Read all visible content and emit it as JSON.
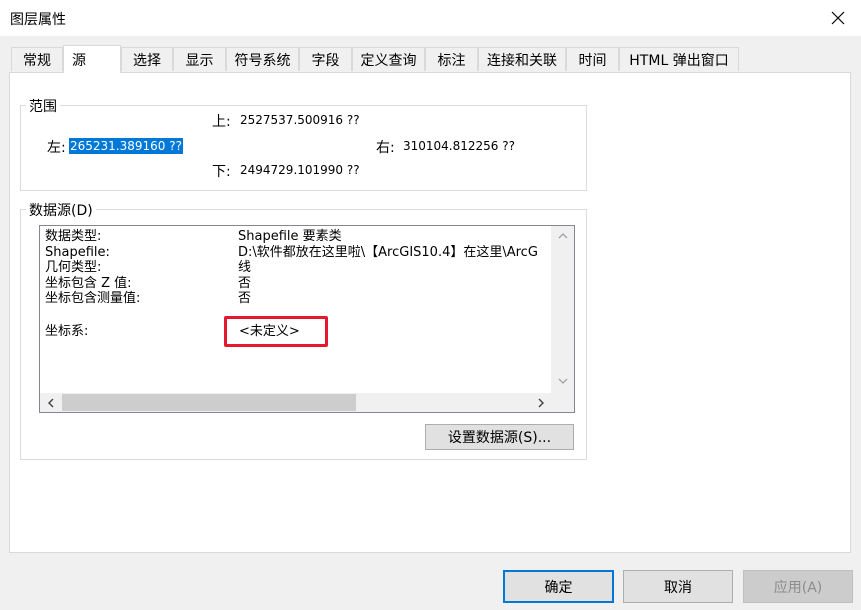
{
  "window": {
    "title": "图层属性"
  },
  "tabs": [
    {
      "label": "常规"
    },
    {
      "label": "源"
    },
    {
      "label": "选择"
    },
    {
      "label": "显示"
    },
    {
      "label": "符号系统"
    },
    {
      "label": "字段"
    },
    {
      "label": "定义查询"
    },
    {
      "label": "标注"
    },
    {
      "label": "连接和关联"
    },
    {
      "label": "时间"
    },
    {
      "label": "HTML 弹出窗口"
    }
  ],
  "active_tab": "源",
  "extent": {
    "title": "范围",
    "top_label": "上:",
    "top_value": "2527537.500916 ??",
    "left_label": "左:",
    "left_value": "265231.389160 ??",
    "right_label": "右:",
    "right_value": "310104.812256 ??",
    "bottom_label": "下:",
    "bottom_value": "2494729.101990 ??"
  },
  "data_source": {
    "title": "数据源(D)",
    "rows": [
      {
        "key": "数据类型:",
        "value": "Shapefile 要素类"
      },
      {
        "key": "Shapefile:",
        "value": "D:\\软件都放在这里啦\\【ArcGIS10.4】在这里\\ArcG"
      },
      {
        "key": "几何类型:",
        "value": "线"
      },
      {
        "key": "坐标包含 Z 值:",
        "value": "否"
      },
      {
        "key": "坐标包含测量值:",
        "value": "否"
      }
    ],
    "coord_key": "坐标系:",
    "coord_value": "<未定义>",
    "set_button": "设置数据源(S)..."
  },
  "buttons": {
    "ok": "确定",
    "cancel": "取消",
    "apply": "应用(A)"
  }
}
